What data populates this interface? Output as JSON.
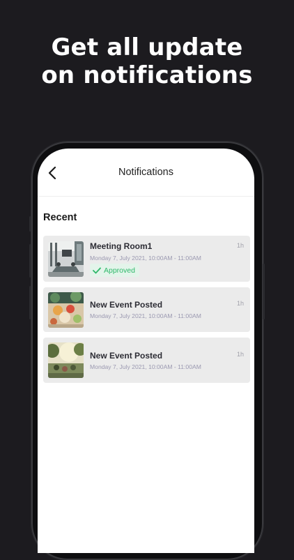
{
  "headline": {
    "line1": "Get all update",
    "line2": "on notifications"
  },
  "nav": {
    "title": "Notifications"
  },
  "section": {
    "title": "Recent"
  },
  "notifications": [
    {
      "title": "Meeting Room1",
      "date": "Monday 7, July 2021, 10:00AM - 11:00AM",
      "time": "1h",
      "badge": "Approved",
      "thumbnail": "meeting-room-photo"
    },
    {
      "title": "New Event Posted",
      "date": "Monday 7, July 2021, 10:00AM - 11:00AM",
      "time": "1h",
      "thumbnail": "event-food-photo"
    },
    {
      "title": "New Event Posted",
      "date": "Monday 7, July 2021, 10:00AM - 11:00AM",
      "time": "1h",
      "thumbnail": "event-outdoor-photo"
    }
  ],
  "colors": {
    "background": "#1c1b1f",
    "approved": "#2fb86a",
    "card": "#ebebeb"
  }
}
